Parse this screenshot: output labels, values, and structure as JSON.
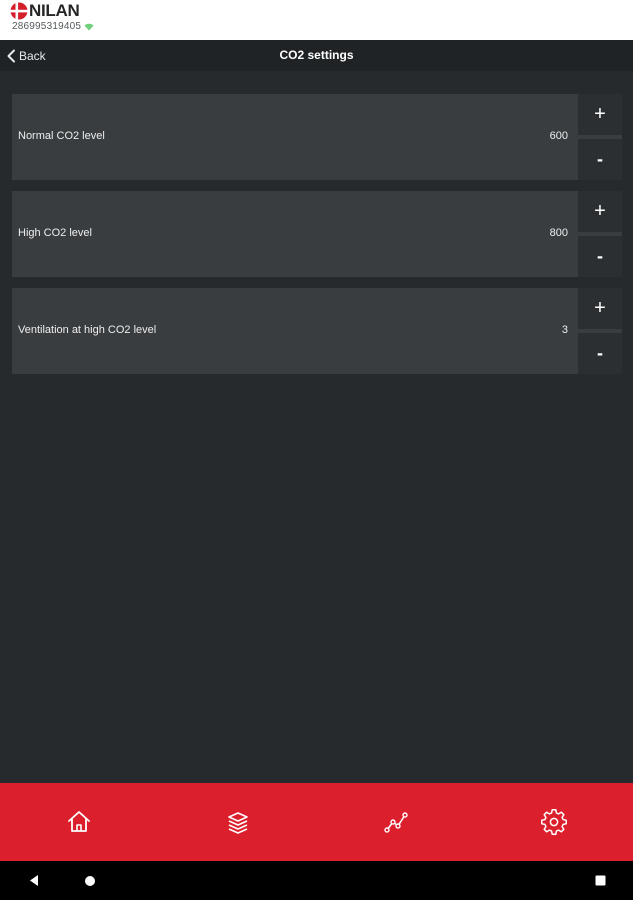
{
  "brand": {
    "logo_text": "NILAN",
    "device_id": "286995319405"
  },
  "navbar": {
    "back_label": "Back",
    "title": "CO2 settings"
  },
  "settings": [
    {
      "label": "Normal CO2 level",
      "value": "600",
      "increment": "+",
      "decrement": "-"
    },
    {
      "label": "High CO2 level",
      "value": "800",
      "increment": "+",
      "decrement": "-"
    },
    {
      "label": "Ventilation at high CO2 level",
      "value": "3",
      "increment": "+",
      "decrement": "-"
    }
  ],
  "tabbar": {
    "background": "#dc1f2c",
    "tabs": [
      {
        "icon": "home-icon"
      },
      {
        "icon": "layers-icon"
      },
      {
        "icon": "graph-icon"
      },
      {
        "icon": "gear-icon"
      }
    ]
  },
  "system_nav": {
    "buttons": [
      "back-triangle-icon",
      "home-circle-icon",
      "recents-square-icon"
    ]
  },
  "colors": {
    "background": "#262a2d",
    "panel": "#393d40",
    "accent": "#dc1f2c"
  }
}
